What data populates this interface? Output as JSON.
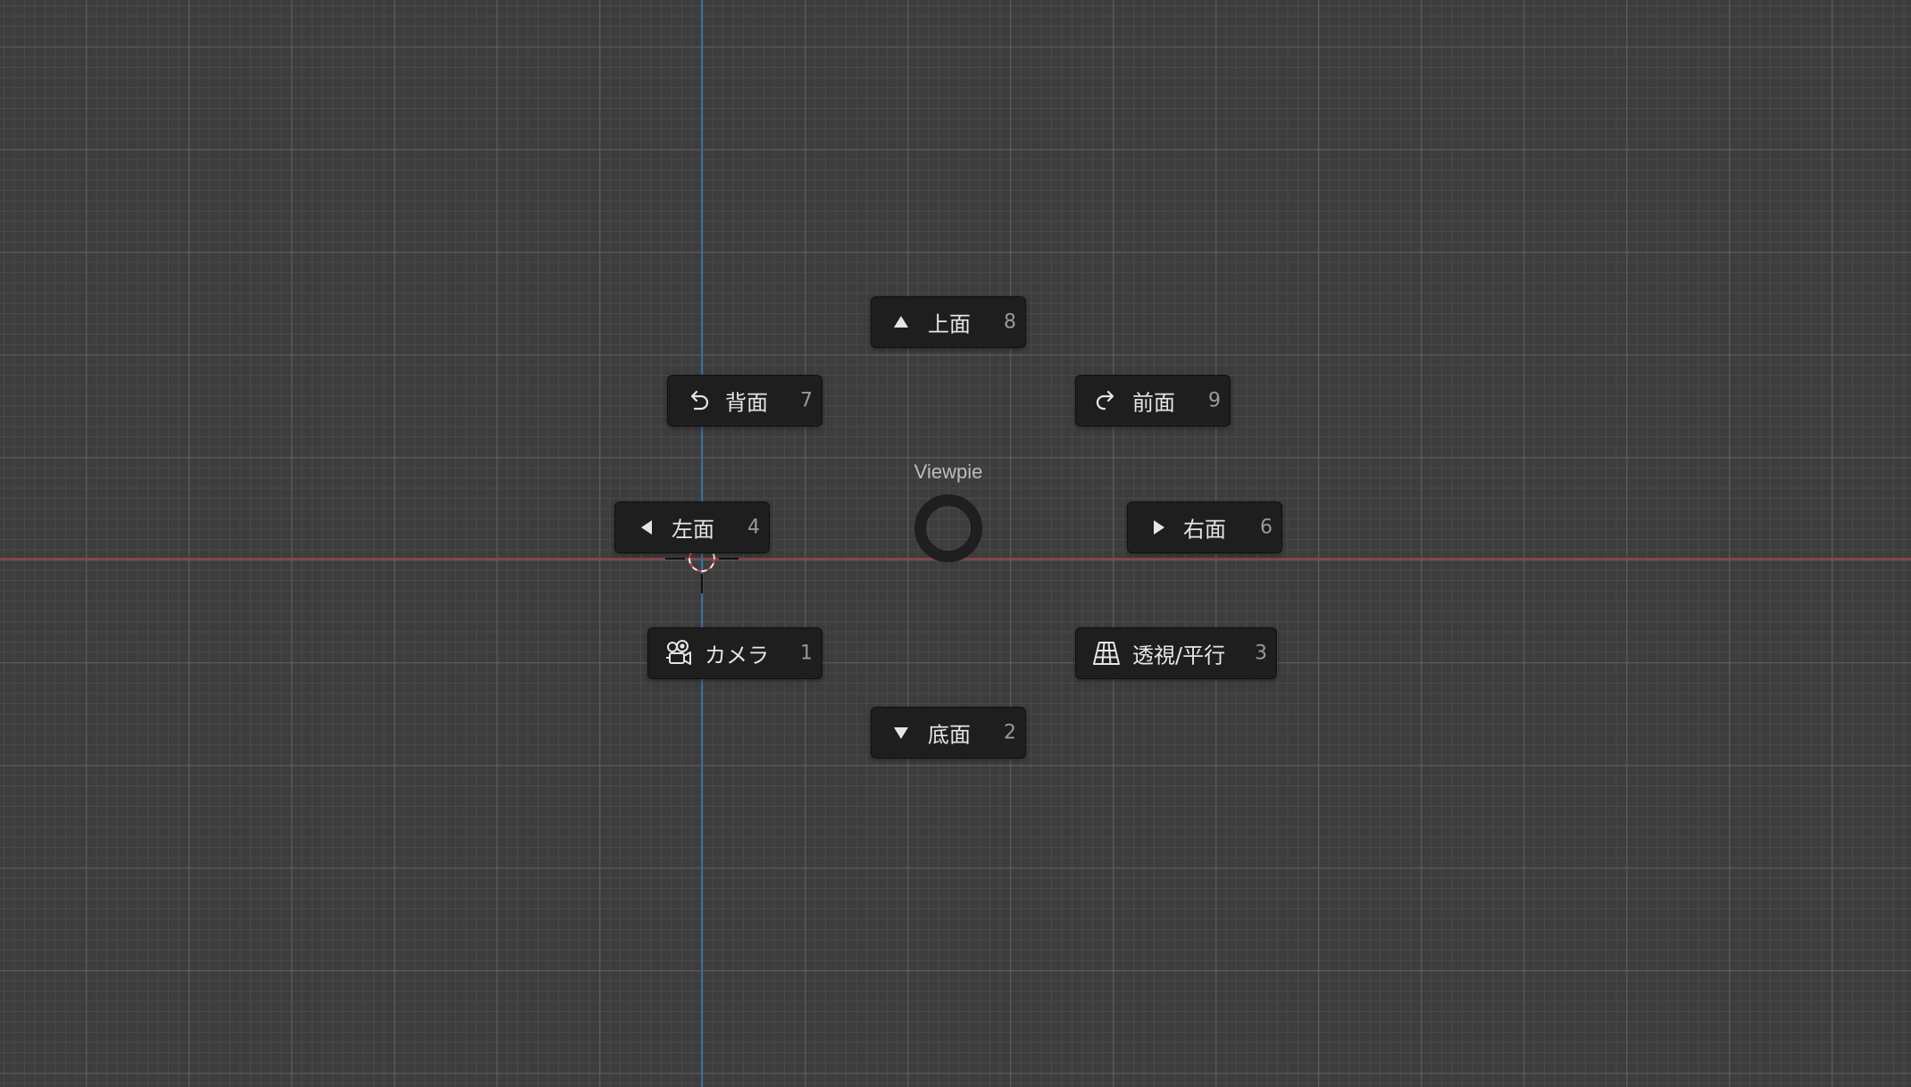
{
  "pie_menu": {
    "title": "Viewpie",
    "items": {
      "top": {
        "label": "上面",
        "key": "8",
        "icon": "triangle-up-icon"
      },
      "back": {
        "label": "背面",
        "key": "7",
        "icon": "rotate-left-icon"
      },
      "front": {
        "label": "前面",
        "key": "9",
        "icon": "rotate-right-icon"
      },
      "left": {
        "label": "左面",
        "key": "4",
        "icon": "triangle-left-icon"
      },
      "right": {
        "label": "右面",
        "key": "6",
        "icon": "triangle-right-icon"
      },
      "camera": {
        "label": "カメラ",
        "key": "1",
        "icon": "camera-icon"
      },
      "perspective": {
        "label": "透視/平行",
        "key": "3",
        "icon": "perspective-grid-icon"
      },
      "bottom": {
        "label": "底面",
        "key": "2",
        "icon": "triangle-down-icon"
      }
    }
  },
  "colors": {
    "background": "#3d3d3d",
    "x_axis": "#8e4249",
    "y_axis": "#3f6aa6",
    "button_bg": "#1e1e1e",
    "button_text": "#e6e6e6",
    "key_text": "#9a9a9a"
  }
}
